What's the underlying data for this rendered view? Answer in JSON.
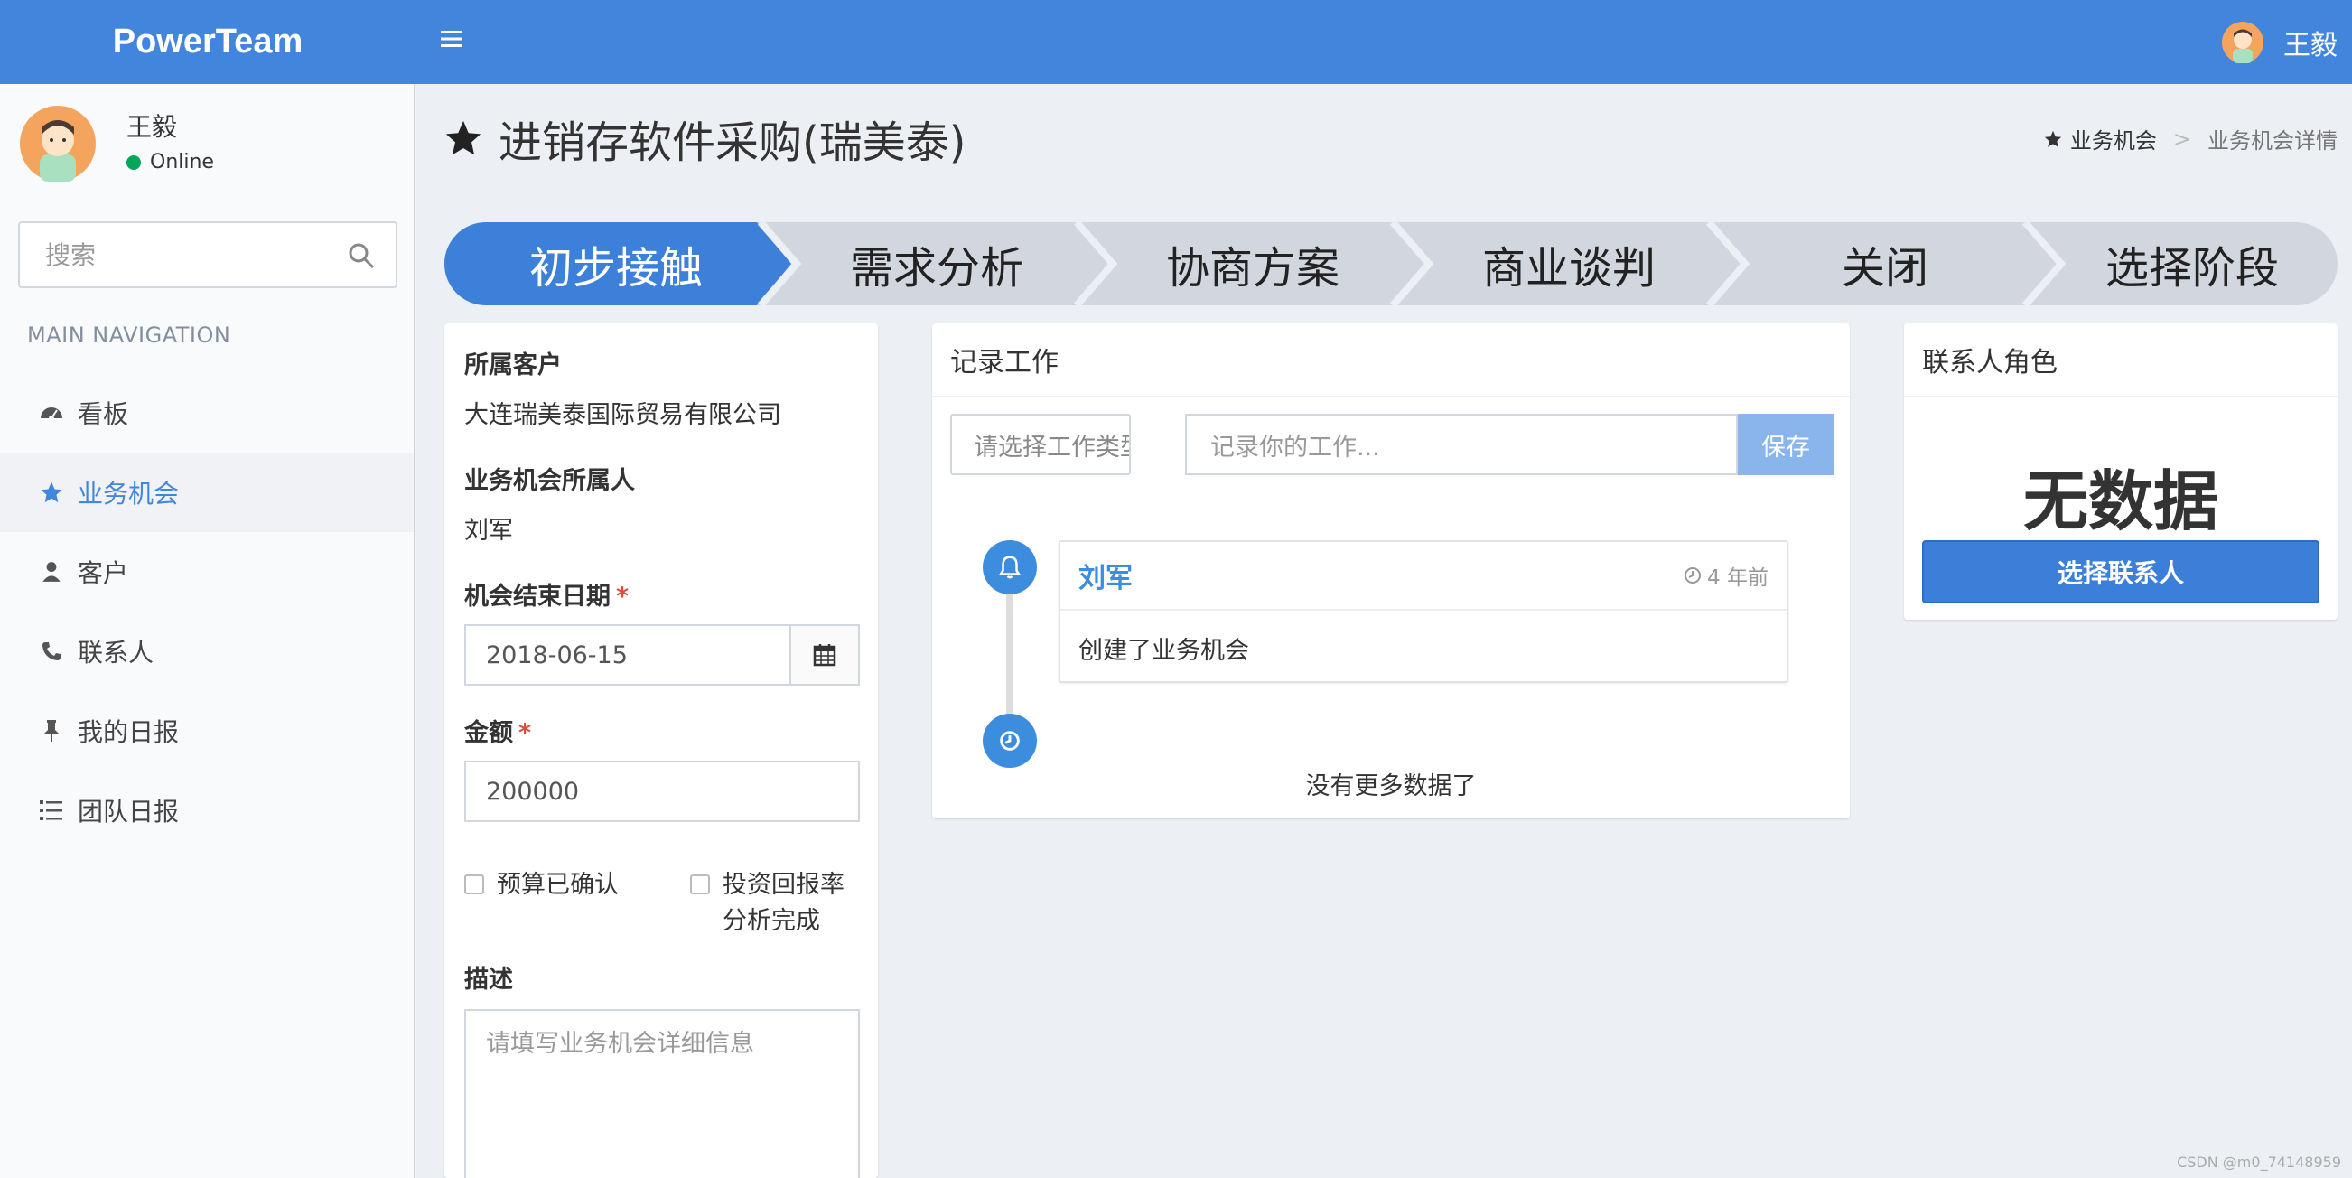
{
  "app": {
    "logo": "PowerTeam",
    "menu_icon": "hamburger-icon"
  },
  "header": {
    "user_name": "王毅"
  },
  "sidebar": {
    "user_name": "王毅",
    "status": "Online",
    "status_color": "#00a65a",
    "search_placeholder": "搜索",
    "nav_header": "MAIN NAVIGATION",
    "items": [
      {
        "label": "看板",
        "icon": "dashboard-icon"
      },
      {
        "label": "业务机会",
        "icon": "star-icon",
        "active": true
      },
      {
        "label": "客户",
        "icon": "user-icon"
      },
      {
        "label": "联系人",
        "icon": "phone-icon"
      },
      {
        "label": "我的日报",
        "icon": "thumbtack-icon"
      },
      {
        "label": "团队日报",
        "icon": "list-icon"
      }
    ]
  },
  "page": {
    "title": "进销存软件采购(瑞美泰)",
    "breadcrumb_home": "业务机会",
    "breadcrumb_current": "业务机会详情"
  },
  "stages": {
    "items": [
      "初步接触",
      "需求分析",
      "协商方案",
      "商业谈判",
      "关闭",
      "选择阶段"
    ],
    "active_index": 0,
    "active_color": "#3d80da",
    "inactive_color": "#d2d6de"
  },
  "details": {
    "customer_label": "所属客户",
    "customer_value": "大连瑞美泰国际贸易有限公司",
    "owner_label": "业务机会所属人",
    "owner_value": "刘军",
    "end_date_label": "机会结束日期",
    "end_date_value": "2018-06-15",
    "amount_label": "金额",
    "amount_value": "200000",
    "required_mark": "*",
    "check_budget": "预算已确认",
    "check_roi_line1": "投资回报率",
    "check_roi_line2": "分析完成",
    "desc_label": "描述",
    "desc_placeholder": "请填写业务机会详细信息"
  },
  "work": {
    "title": "记录工作",
    "type_placeholder": "请选择工作类型",
    "input_placeholder": "记录你的工作...",
    "save_label": "保存",
    "timeline": {
      "author": "刘军",
      "time": "4 年前",
      "content": "创建了业务机会"
    },
    "no_more": "没有更多数据了"
  },
  "contacts": {
    "title": "联系人角色",
    "empty": "无数据",
    "select_button": "选择联系人"
  },
  "watermark": "CSDN @m0_74148959"
}
